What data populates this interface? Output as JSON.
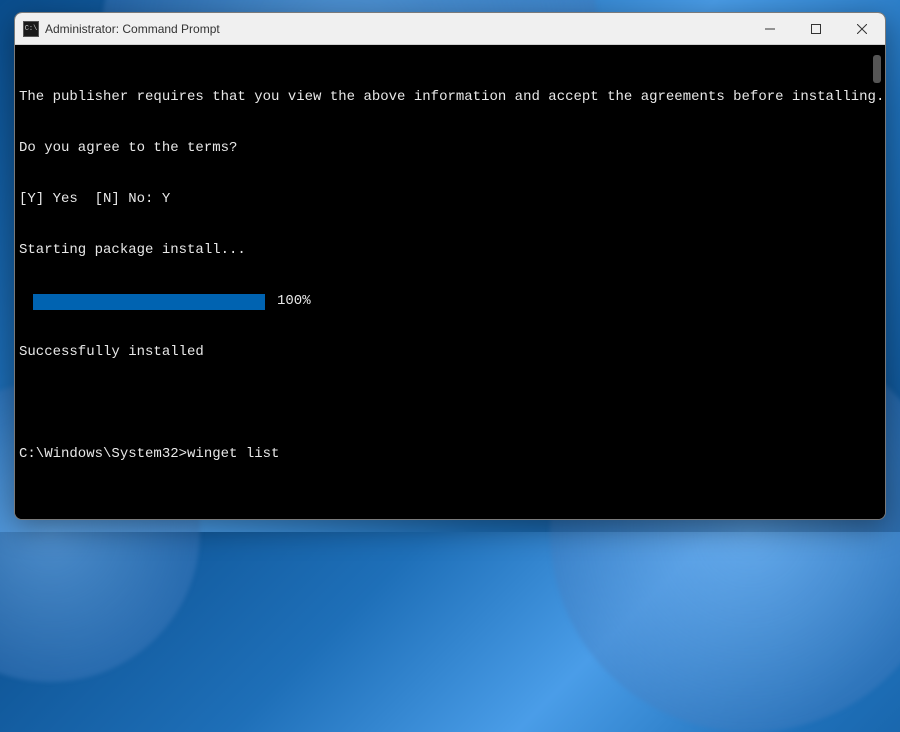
{
  "window": {
    "title": "Administrator: Command Prompt",
    "icon_text": "C:\\"
  },
  "terminal": {
    "lines": {
      "l1": "The publisher requires that you view the above information and accept the agreements before installing.",
      "l2": "Do you agree to the terms?",
      "l3": "[Y] Yes  [N] No: Y",
      "l4": "Starting package install...",
      "progress_pct": "100%",
      "l5": "Successfully installed"
    },
    "prompt": "C:\\Windows\\System32>",
    "command": "winget list"
  }
}
